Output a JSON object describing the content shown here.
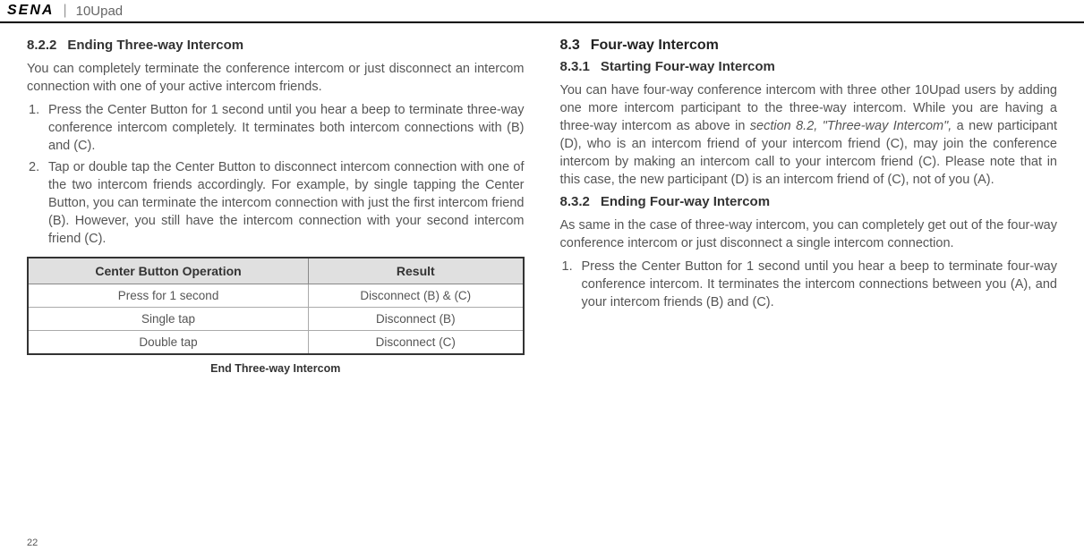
{
  "header": {
    "logo": "SENA",
    "product": "10Upad"
  },
  "left": {
    "h1_num": "8.2.2",
    "h1_title": "Ending Three-way Intercom",
    "p1": "You can completely terminate the conference intercom or just disconnect an intercom connection with one of your active intercom friends.",
    "li1_num": "1.",
    "li1_text": "Press the Center Button for 1 second until you hear a beep to terminate three-way conference intercom completely. It terminates both intercom connections with (B) and (C).",
    "li2_num": "2.",
    "li2_text": "Tap or double tap the Center Button to disconnect intercom connection with one of the two intercom friends accordingly. For example, by single tapping the Center Button, you can terminate the intercom connection with just the first intercom friend (B). However, you still have the intercom connection with your second intercom friend (C).",
    "table": {
      "th1": "Center Button Operation",
      "th2": "Result",
      "rows": [
        {
          "op": "Press for 1 second",
          "res": "Disconnect (B) & (C)"
        },
        {
          "op": "Single tap",
          "res": "Disconnect (B)"
        },
        {
          "op": "Double tap",
          "res": "Disconnect (C)"
        }
      ],
      "caption": "End Three-way Intercom"
    }
  },
  "right": {
    "h_main_num": "8.3",
    "h_main_title": "Four-way Intercom",
    "h1_num": "8.3.1",
    "h1_title": "Starting Four-way Intercom",
    "p1a": "You can have four-way conference intercom with three other 10Upad users by adding one more intercom participant to the three-way intercom. While you are having a three-way intercom as above in ",
    "p1_ref": "section 8.2, \"Three-way Intercom\",",
    "p1b": " a new participant (D), who is an intercom friend of your intercom friend (C), may join the conference intercom by making an intercom call to your intercom friend (C). Please note that in this case, the new participant (D) is an intercom friend of (C), not of you (A).",
    "h2_num": "8.3.2",
    "h2_title": "Ending Four-way Intercom",
    "p2": "As same in the case of three-way intercom, you can completely get out of the four-way conference intercom or just disconnect a single intercom connection.",
    "li1_num": "1.",
    "li1_text": "Press the Center Button for 1 second until you hear a beep to terminate four-way conference intercom. It terminates the intercom connections between you (A), and your intercom friends (B) and (C)."
  },
  "page_number": "22"
}
